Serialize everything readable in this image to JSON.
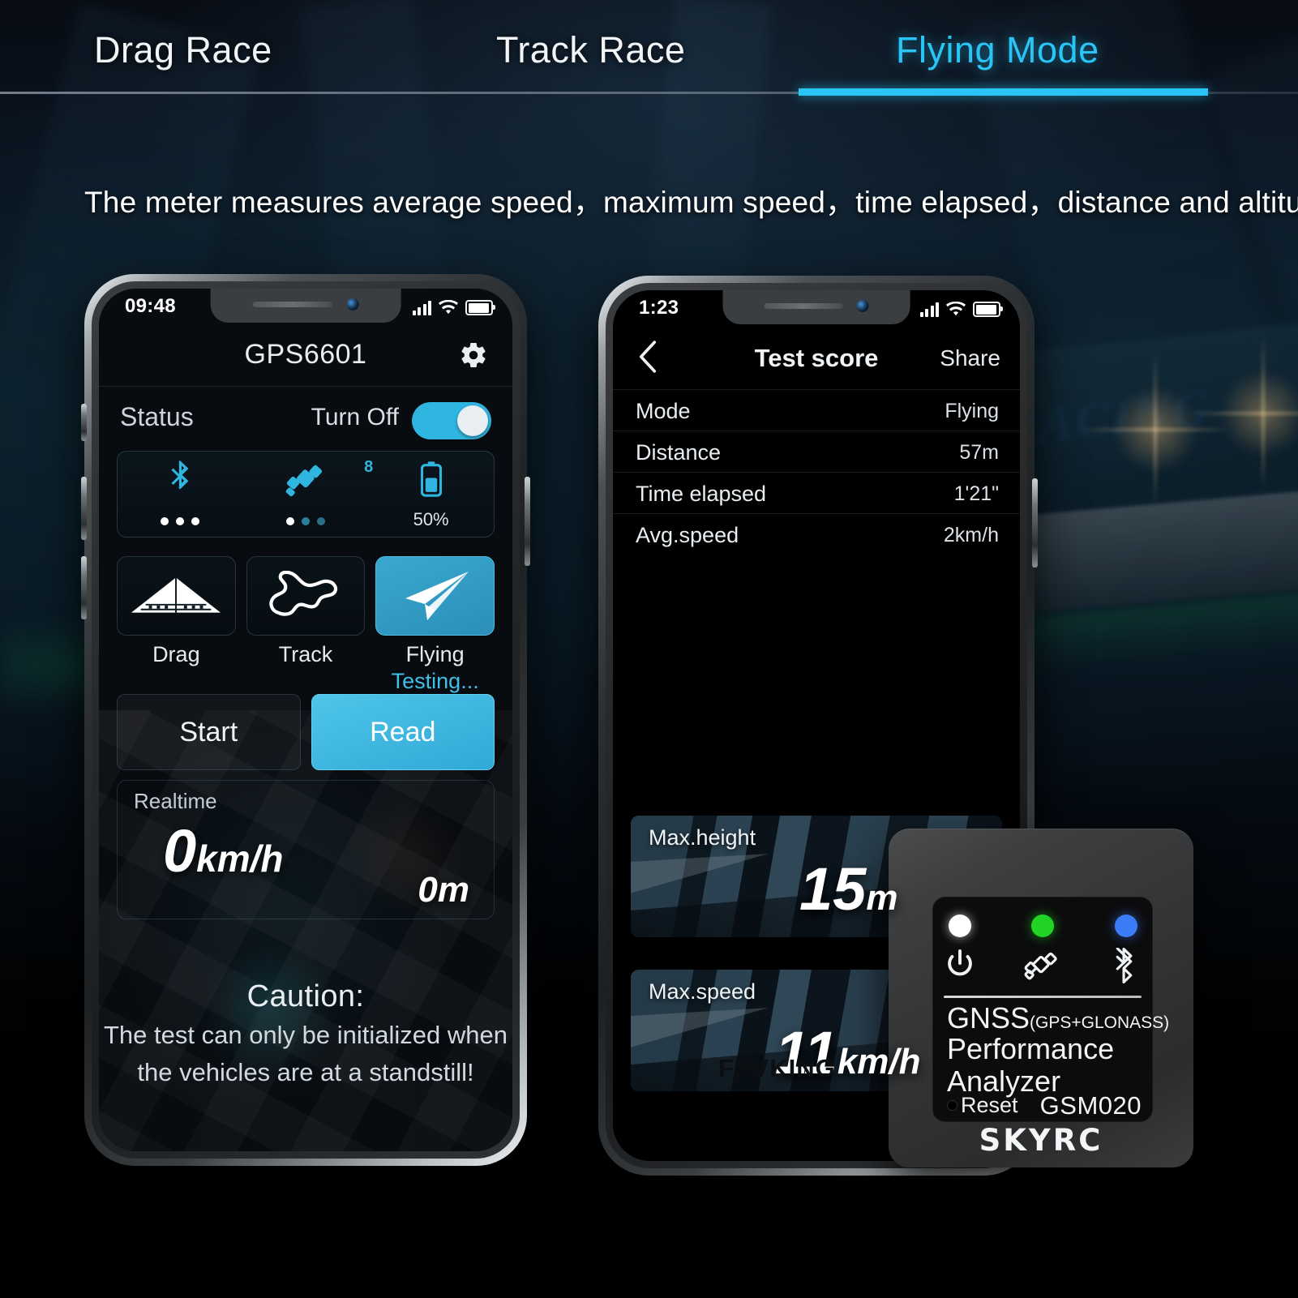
{
  "tabs": [
    {
      "label": "Drag Race",
      "active": false
    },
    {
      "label": "Track Race",
      "active": false
    },
    {
      "label": "Flying Mode",
      "active": true
    }
  ],
  "subtitle": "The meter measures average speed，maximum speed，time elapsed，distance and altitude.",
  "accent_color": "#29c5f6",
  "phone_left": {
    "status_bar": {
      "time": "09:48",
      "signal_icon": "signal-bars-icon",
      "wifi_icon": "wifi-icon",
      "battery_icon": "battery-icon"
    },
    "nav": {
      "title": "GPS6601",
      "settings_icon": "gear-icon"
    },
    "status_row": {
      "label": "Status",
      "toggle_label": "Turn Off",
      "toggle_on": true
    },
    "status_cells": [
      {
        "icon": "bluetooth-icon",
        "dots": 3,
        "caption": ""
      },
      {
        "icon": "satellite-icon",
        "badge": "8",
        "dots": 3,
        "caption": ""
      },
      {
        "icon": "battery-vertical-icon",
        "caption": "50%"
      }
    ],
    "modes": [
      {
        "icon": "drag-bridge-icon",
        "label": "Drag",
        "state": "",
        "selected": false
      },
      {
        "icon": "track-circuit-icon",
        "label": "Track",
        "state": "",
        "selected": false
      },
      {
        "icon": "paper-plane-icon",
        "label": "Flying",
        "state": "Testing...",
        "selected": true
      }
    ],
    "actions": [
      {
        "label": "Start",
        "primary": false
      },
      {
        "label": "Read",
        "primary": true
      }
    ],
    "realtime": {
      "label": "Realtime",
      "speed_value": "0",
      "speed_unit": "km/h",
      "altitude": "0m"
    },
    "caution": {
      "heading": "Caution:",
      "line1": "The test can only be initialized when",
      "line2": "the vehicles are at a standstill!"
    }
  },
  "phone_right": {
    "status_bar": {
      "time": "1:23",
      "signal_icon": "signal-bars-icon",
      "wifi_icon": "wifi-icon",
      "battery_icon": "battery-icon"
    },
    "nav": {
      "back_icon": "chevron-left-icon",
      "title": "Test score",
      "share_label": "Share"
    },
    "rows": [
      {
        "key": "Mode",
        "value": "Flying"
      },
      {
        "key": "Distance",
        "value": "57m"
      },
      {
        "key": "Time elapsed",
        "value": "1'21\""
      },
      {
        "key": "Avg.speed",
        "value": "2km/h"
      }
    ],
    "cards": [
      {
        "label": "Max.height",
        "value": "15",
        "unit": "m"
      },
      {
        "label": "Max.speed",
        "value": "11",
        "unit": "km/h"
      }
    ],
    "watermark": "FPVKING"
  },
  "device": {
    "leds": [
      {
        "name": "power-led",
        "color": "#ffffff",
        "icon": "power-icon"
      },
      {
        "name": "gnss-led",
        "color": "#21d324",
        "icon": "satellite-icon"
      },
      {
        "name": "bluetooth-led",
        "color": "#3b7cf7",
        "icon": "bluetooth-icon"
      }
    ],
    "title_main": "GNSS",
    "title_sub": "(GPS+GLONASS)",
    "title_line2": "Performance",
    "title_line3": "Analyzer",
    "reset_label": "Reset",
    "model": "GSM020",
    "brand": "SKYRC"
  },
  "background": {
    "billboard_text": "RACING"
  }
}
